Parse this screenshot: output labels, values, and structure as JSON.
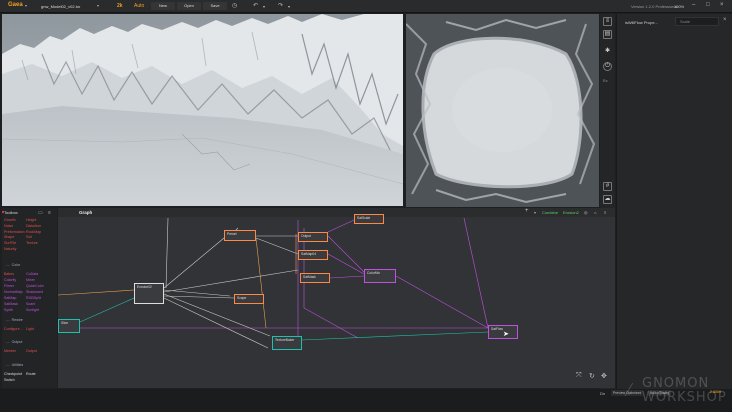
{
  "topbar": {
    "logo": "Gaea",
    "file_name": "gnw_Model02_v02.tor",
    "resolution": "2k",
    "build_mode": "Auto",
    "new_label": "New",
    "open_label": "Open",
    "save_label": "Save",
    "version": "Version 1.2.0 Professional",
    "zoom": "100%"
  },
  "properties": {
    "title": "isWillFlow Prope...",
    "search_placeholder": "Scale"
  },
  "right_strip": {
    "label": "Ex"
  },
  "viewport": {
    "build_progress": 0.85
  },
  "toolbox": {
    "title": "Toolbox",
    "primitives": [
      {
        "label": "Growth",
        "color": "#e05050"
      },
      {
        "label": "Noise",
        "color": "#e05050"
      },
      {
        "label": "Preformation",
        "color": "#e05050"
      },
      {
        "label": "Shape",
        "color": "#e05050"
      },
      {
        "label": "SurfTile",
        "color": "#e05050"
      },
      {
        "label": "Naturity",
        "color": "#e05050"
      }
    ],
    "primitives_right": [
      {
        "label": "Height",
        "color": "#e05050"
      },
      {
        "label": "Distortion",
        "color": "#e05050"
      },
      {
        "label": "RockMap",
        "color": "#e05050"
      },
      {
        "label": "Soil",
        "color": "#e05050"
      },
      {
        "label": "Texture",
        "color": "#e05050"
      }
    ],
    "section_color": "Color",
    "color_items": [
      {
        "label": "Bakes",
        "color": "#e05050"
      },
      {
        "label": "Colorify",
        "color": "#c050e0"
      },
      {
        "label": "Filmer",
        "color": "#c050e0"
      },
      {
        "label": "NormalMap",
        "color": "#c050e0"
      },
      {
        "label": "SatMap",
        "color": "#c050e0"
      },
      {
        "label": "SatMask",
        "color": "#c050e0"
      },
      {
        "label": "Synth",
        "color": "#c050e0"
      }
    ],
    "color_items_right": [
      {
        "label": "CoData",
        "color": "#c050e0"
      },
      {
        "label": "Mixer",
        "color": "#c050e0"
      },
      {
        "label": "QuickColor",
        "color": "#c050e0"
      },
      {
        "label": "Shadowed",
        "color": "#c050e0"
      },
      {
        "label": "RGBSplit",
        "color": "#c050e0"
      },
      {
        "label": "Scant",
        "color": "#c050e0"
      },
      {
        "label": "Sunlight",
        "color": "#c050e0"
      }
    ],
    "section_rewire": "Rewire",
    "rewire_items": [
      {
        "label": "Configure...",
        "color": "#e05050"
      }
    ],
    "rewire_items_right": [
      {
        "label": "Light",
        "color": "#e05050"
      }
    ],
    "section_output": "Output",
    "output_items": [
      {
        "label": "Mesher",
        "color": "#e05050"
      }
    ],
    "output_items_right": [
      {
        "label": "Output",
        "color": "#e05050"
      }
    ],
    "section_utilities": "Utilities",
    "utility_items": [
      {
        "label": "Checkpoint",
        "color": "#dddddd"
      },
      {
        "label": "Switch",
        "color": "#dddddd"
      }
    ],
    "utility_items_right": [
      {
        "label": "Route",
        "color": "#dddddd"
      }
    ]
  },
  "graph": {
    "title": "Graph",
    "combine_label": "Combine",
    "erosion_label": "Erosion2",
    "nodes": [
      {
        "label": "Preset",
        "color": "#ff8844"
      },
      {
        "label": "Erosion02",
        "color": "#dddddd"
      },
      {
        "label": "Output",
        "color": "#ff8844"
      },
      {
        "label": "Scape",
        "color": "#ff8844"
      },
      {
        "label": "SatMap04",
        "color": "#ff8844"
      },
      {
        "label": "SatMask",
        "color": "#ff8844"
      },
      {
        "label": "SatScale",
        "color": "#ff8844"
      },
      {
        "label": "ColorMix",
        "color": "#c050e0"
      },
      {
        "label": "TextureBaker",
        "color": "#20c0b0"
      },
      {
        "label": "SatFlow",
        "color": "#c050e0"
      },
      {
        "label": "Slice",
        "color": "#20c0b0"
      },
      {
        "label": "Sand",
        "color": "#c050e0"
      }
    ]
  },
  "status": {
    "preview_label": "Preview Optimized",
    "build_label": "Build Quality",
    "value": "2.8889"
  },
  "watermark": {
    "line1": "GNOMON",
    "line2": "WORKSHOP"
  }
}
